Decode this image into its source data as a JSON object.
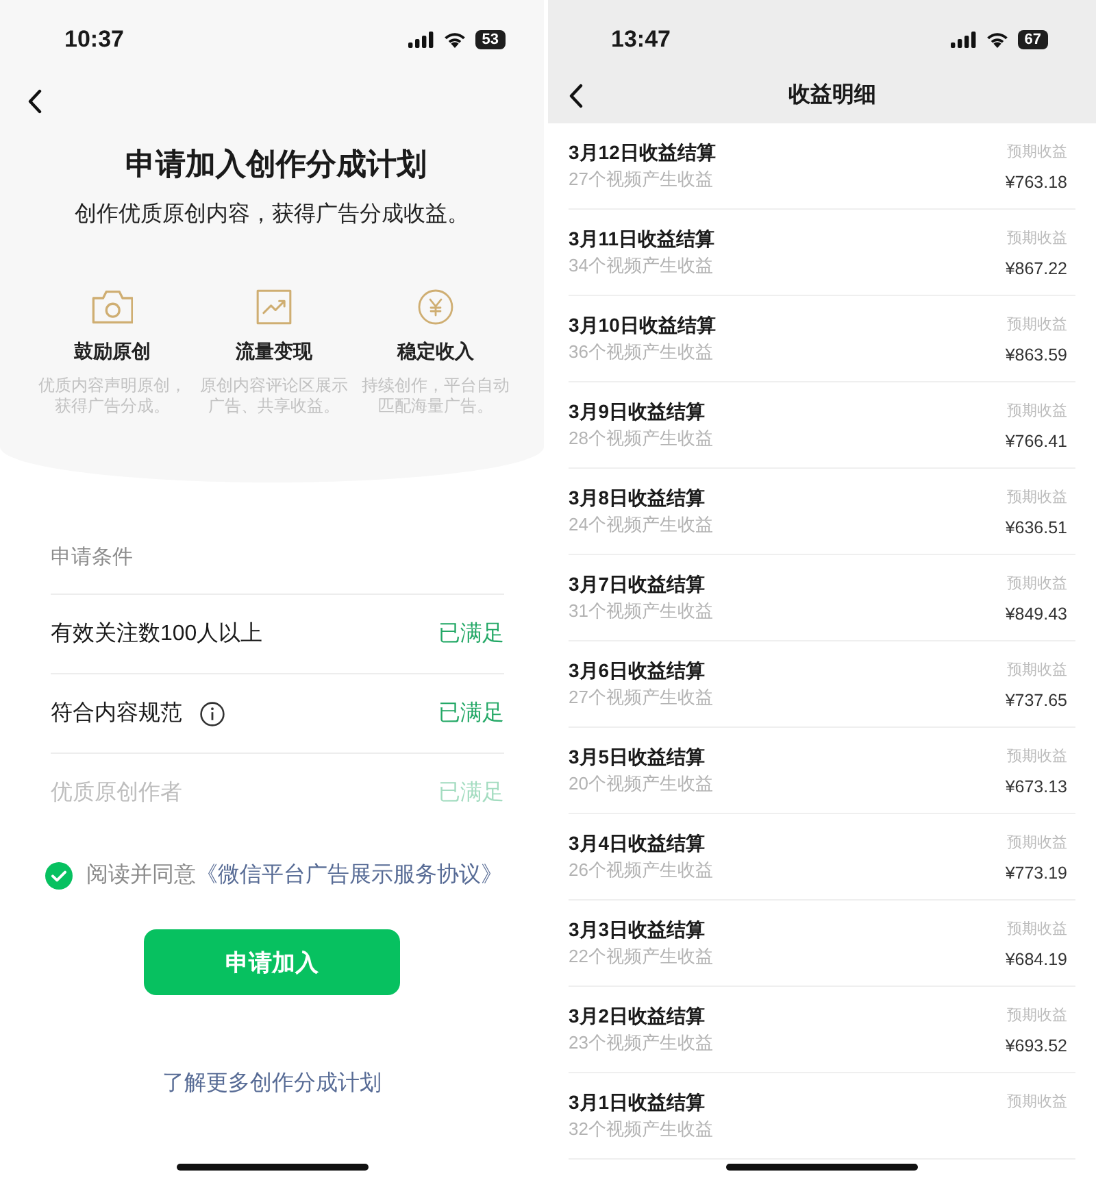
{
  "application_page": {
    "status_bar": {
      "time": "10:37",
      "battery": "53"
    },
    "title": "申请加入创作分成计划",
    "subtitle": "创作优质原创内容，获得广告分成收益。",
    "features": [
      {
        "title": "鼓励原创",
        "description": "优质内容声明原创，获得广告分成。"
      },
      {
        "title": "流量变现",
        "description": "原创内容评论区展示广告、共享收益。"
      },
      {
        "title": "稳定收入",
        "description": "持续创作，平台自动匹配海量广告。"
      }
    ],
    "conditions": {
      "heading": "申请条件",
      "items": [
        {
          "label": "有效关注数100人以上",
          "status": "已满足",
          "info": false,
          "dimmed": false
        },
        {
          "label": "符合内容规范",
          "status": "已满足",
          "info": true,
          "dimmed": false
        },
        {
          "label": "优质原创作者",
          "status": "已满足",
          "info": false,
          "dimmed": true
        }
      ]
    },
    "agreement": {
      "checked": true,
      "text": "阅读并同意",
      "link": "《微信平台广告展示服务协议》"
    },
    "apply_button": "申请加入",
    "learn_more_link": "了解更多创作分成计划"
  },
  "earnings_page": {
    "status_bar": {
      "time": "13:47",
      "battery": "67"
    },
    "title": "收益明细",
    "rows": [
      {
        "title": "3月12日收益结算",
        "subtitle": "27个视频产生收益",
        "label": "预期收益",
        "amount": "¥763.18"
      },
      {
        "title": "3月11日收益结算",
        "subtitle": "34个视频产生收益",
        "label": "预期收益",
        "amount": "¥867.22"
      },
      {
        "title": "3月10日收益结算",
        "subtitle": "36个视频产生收益",
        "label": "预期收益",
        "amount": "¥863.59"
      },
      {
        "title": "3月9日收益结算",
        "subtitle": "28个视频产生收益",
        "label": "预期收益",
        "amount": "¥766.41"
      },
      {
        "title": "3月8日收益结算",
        "subtitle": "24个视频产生收益",
        "label": "预期收益",
        "amount": "¥636.51"
      },
      {
        "title": "3月7日收益结算",
        "subtitle": "31个视频产生收益",
        "label": "预期收益",
        "amount": "¥849.43"
      },
      {
        "title": "3月6日收益结算",
        "subtitle": "27个视频产生收益",
        "label": "预期收益",
        "amount": "¥737.65"
      },
      {
        "title": "3月5日收益结算",
        "subtitle": "20个视频产生收益",
        "label": "预期收益",
        "amount": "¥673.13"
      },
      {
        "title": "3月4日收益结算",
        "subtitle": "26个视频产生收益",
        "label": "预期收益",
        "amount": "¥773.19"
      },
      {
        "title": "3月3日收益结算",
        "subtitle": "22个视频产生收益",
        "label": "预期收益",
        "amount": "¥684.19"
      },
      {
        "title": "3月2日收益结算",
        "subtitle": "23个视频产生收益",
        "label": "预期收益",
        "amount": "¥693.52"
      },
      {
        "title": "3月1日收益结算",
        "subtitle": "32个视频产生收益",
        "label": "预期收益"
      }
    ]
  }
}
